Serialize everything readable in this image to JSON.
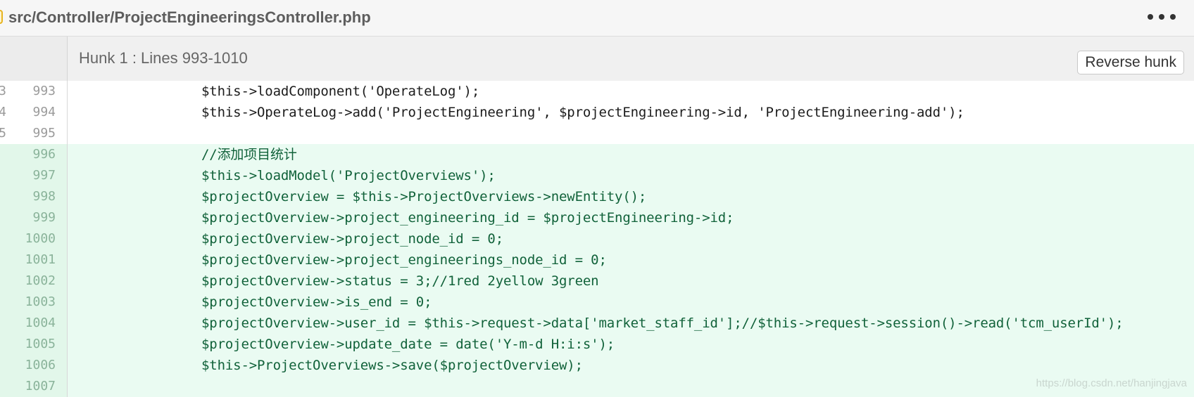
{
  "file": {
    "path": "src/Controller/ProjectEngineeringsController.php",
    "icon": "php-file-icon",
    "more_icon": "ellipsis-icon"
  },
  "hunk": {
    "title": "Hunk 1 : Lines 993-1010",
    "reverse_label": "Reverse hunk"
  },
  "lines": [
    {
      "type": "context",
      "old": "3",
      "new": "993",
      "text": "$this->loadComponent('OperateLog');"
    },
    {
      "type": "context",
      "old": "4",
      "new": "994",
      "text": "$this->OperateLog->add('ProjectEngineering', $projectEngineering->id, 'ProjectEngineering-add');"
    },
    {
      "type": "context",
      "old": "5",
      "new": "995",
      "text": ""
    },
    {
      "type": "added",
      "old": "",
      "new": "996",
      "text": "//添加项目统计"
    },
    {
      "type": "added",
      "old": "",
      "new": "997",
      "text": "$this->loadModel('ProjectOverviews');"
    },
    {
      "type": "added",
      "old": "",
      "new": "998",
      "text": "$projectOverview = $this->ProjectOverviews->newEntity();"
    },
    {
      "type": "added",
      "old": "",
      "new": "999",
      "text": "$projectOverview->project_engineering_id = $projectEngineering->id;"
    },
    {
      "type": "added",
      "old": "",
      "new": "1000",
      "text": "$projectOverview->project_node_id = 0;"
    },
    {
      "type": "added",
      "old": "",
      "new": "1001",
      "text": "$projectOverview->project_engineerings_node_id = 0;"
    },
    {
      "type": "added",
      "old": "",
      "new": "1002",
      "text": "$projectOverview->status = 3;//1red 2yellow 3green"
    },
    {
      "type": "added",
      "old": "",
      "new": "1003",
      "text": "$projectOverview->is_end = 0;"
    },
    {
      "type": "added",
      "old": "",
      "new": "1004",
      "text": "$projectOverview->user_id = $this->request->data['market_staff_id'];//$this->request->session()->read('tcm_userId');"
    },
    {
      "type": "added",
      "old": "",
      "new": "1005",
      "text": "$projectOverview->update_date = date('Y-m-d H:i:s');"
    },
    {
      "type": "added",
      "old": "",
      "new": "1006",
      "text": "$this->ProjectOverviews->save($projectOverview);"
    },
    {
      "type": "added",
      "old": "",
      "new": "1007",
      "text": ""
    }
  ],
  "watermark": "https://blog.csdn.net/hanjingjava",
  "colors": {
    "added_bg": "#eafbf2",
    "added_text": "#11623a",
    "context_bg": "#ffffff"
  }
}
